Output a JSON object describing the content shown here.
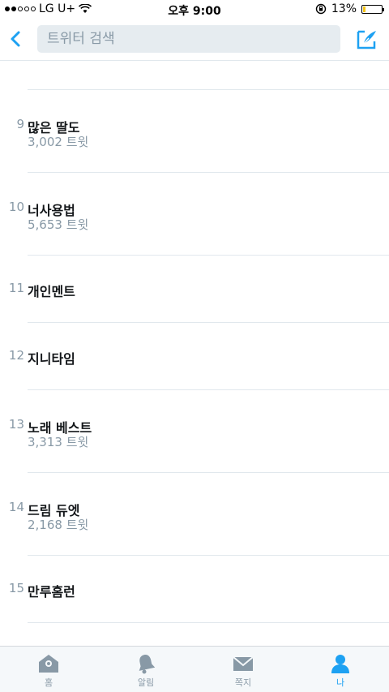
{
  "status_bar": {
    "carrier": "LG U+",
    "time": "오후 9:00",
    "battery": "13%",
    "battery_level": 0.13
  },
  "header": {
    "search_placeholder": "트위터 검색",
    "back_icon": "chevron-left-icon",
    "compose_icon": "compose-icon"
  },
  "trends": [
    {
      "rank": "9",
      "topic": "많은 딸도",
      "count": "3,002 트윗"
    },
    {
      "rank": "10",
      "topic": "너사용법",
      "count": "5,653 트윗"
    },
    {
      "rank": "11",
      "topic": "개인멘트",
      "count": ""
    },
    {
      "rank": "12",
      "topic": "지니타임",
      "count": ""
    },
    {
      "rank": "13",
      "topic": "노래 베스트",
      "count": "3,313 트윗"
    },
    {
      "rank": "14",
      "topic": "드림 듀엣",
      "count": "2,168 트윗"
    },
    {
      "rank": "15",
      "topic": "만루홈런",
      "count": ""
    }
  ],
  "tabs": [
    {
      "label": "홈",
      "icon": "home-icon"
    },
    {
      "label": "알림",
      "icon": "bell-icon"
    },
    {
      "label": "쪽지",
      "icon": "envelope-icon"
    },
    {
      "label": "나",
      "icon": "person-icon"
    }
  ],
  "colors": {
    "accent": "#1da1f2",
    "inactive": "#8899a6"
  }
}
